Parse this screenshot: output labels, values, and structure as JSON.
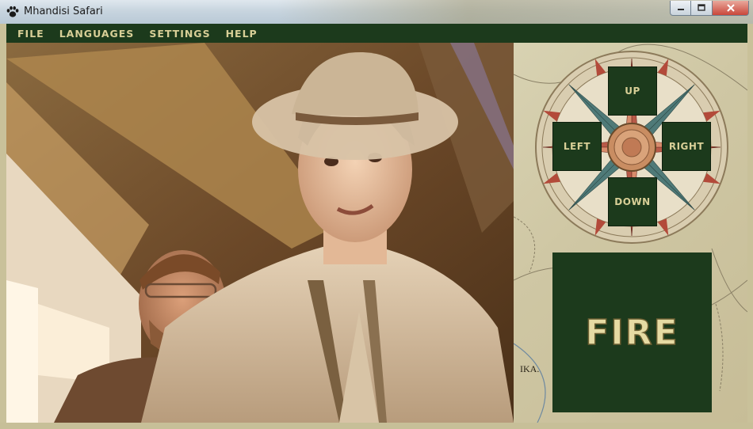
{
  "window": {
    "title": "Mhandisi Safari"
  },
  "menu": {
    "items": [
      {
        "label": "FILE"
      },
      {
        "label": "LANGUAGES"
      },
      {
        "label": "SETTINGS"
      },
      {
        "label": "HELP"
      }
    ]
  },
  "controls": {
    "up_label": "UP",
    "left_label": "LEFT",
    "right_label": "RIGHT",
    "down_label": "DOWN",
    "fire_label": "FIRE"
  },
  "map_text": {
    "label_ika": "IKA."
  },
  "colors": {
    "menu_bg": "#1c3a1c",
    "menu_text": "#d8cf97",
    "fire_text": "#e6dba3"
  },
  "icons": {
    "app": "paw-icon",
    "minimize": "minimize-icon",
    "maximize": "maximize-icon",
    "close": "close-icon"
  }
}
